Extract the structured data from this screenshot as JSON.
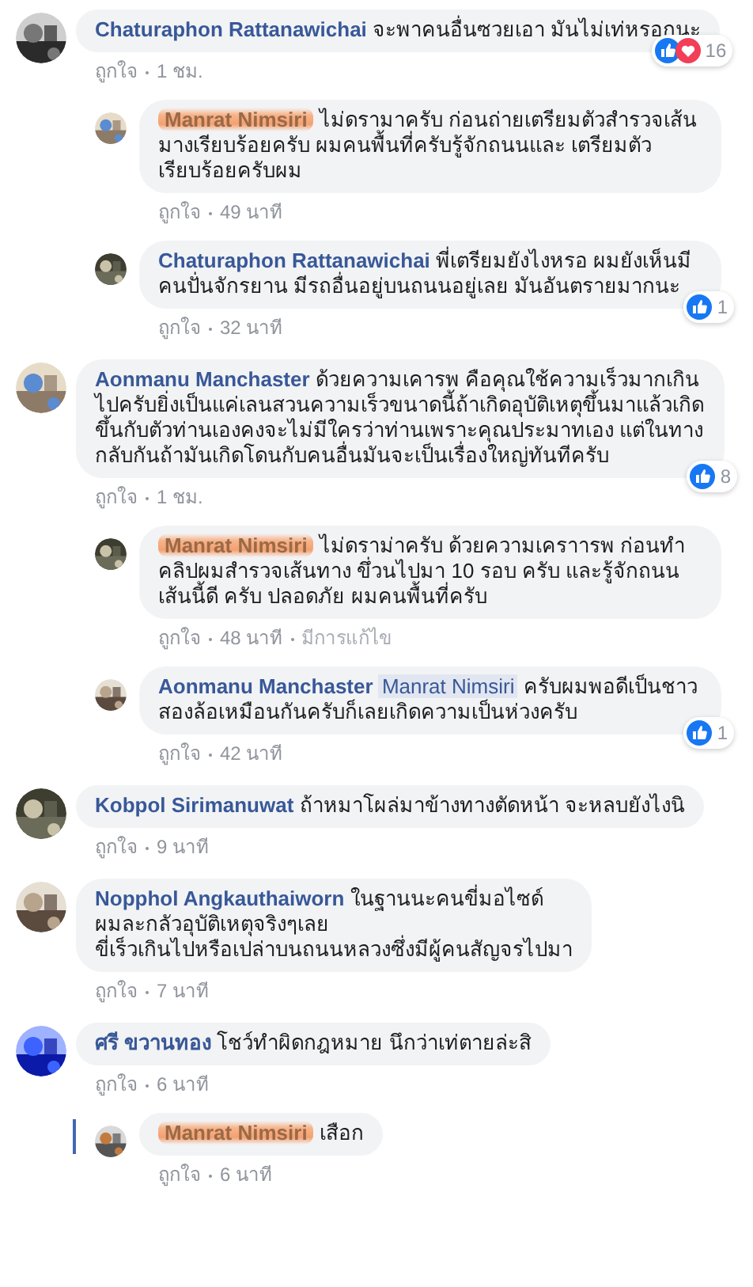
{
  "comments": [
    {
      "author": "Chaturaphon Rattanawichai",
      "redacted": false,
      "text": "จะพาคนอื่นซวยเอา มันไม่เท่หรอกนะ",
      "like": "ถูกใจ",
      "time": "1 ชม.",
      "reactions": {
        "like": true,
        "love": true,
        "count": "16"
      },
      "replies": [
        {
          "author": "Manrat Nimsiri",
          "redacted": true,
          "text": "ไม่ดรามาครับ ก่อนถ่ายเตรียมตัวสำรวจเส้นมางเรียบร้อยครับ ผมคนพื้นที่ครับรู้จักถนนและ เตรียมตัวเรียบร้อยครับผม",
          "like": "ถูกใจ",
          "time": "49 นาที"
        },
        {
          "author": "Chaturaphon Rattanawichai",
          "redacted": false,
          "text": "พี่เตรียมยังไงหรอ ผมยังเห็นมีคนปั่นจักรยาน มีรถอื่นอยู่บนถนนอยู่เลย มันอันตรายมากนะ",
          "like": "ถูกใจ",
          "time": "32 นาที",
          "reactions": {
            "like": true,
            "love": false,
            "count": "1"
          }
        }
      ]
    },
    {
      "author": "Aonmanu Manchaster",
      "redacted": false,
      "text": "ด้วยความเคารพ คือคุณใช้ความเร็วมากเกินไปครับยิ่งเป็นแค่เลนสวนความเร็วขนาดนี้ถ้าเกิดอุบัติเหตุขึ้นมาแล้วเกิดขึ้นกับตัวท่านเองคงจะไม่มีใครว่าท่านเพราะคุณประมาทเอง แต่ในทางกลับกันถ้ามันเกิดโดนกับคนอื่นมันจะเป็นเรื่องใหญ่ทันทีครับ",
      "like": "ถูกใจ",
      "time": "1 ชม.",
      "reactions": {
        "like": true,
        "love": false,
        "count": "8"
      },
      "replies": [
        {
          "author": "Manrat Nimsiri",
          "redacted": true,
          "text": "ไม่ดราม่าครับ ด้วยความเคราารพ ก่อนทำคลิปผมสำรวจเส้นทาง ขึ่วนไปมา 10 รอบ ครับ และรู้จักถนนเส้นนี้ดี ครับ ปลอดภัย ผมคนพื้นที่ครับ",
          "like": "ถูกใจ",
          "time": "48 นาที",
          "edited": "มีการแก้ไข"
        },
        {
          "author": "Aonmanu Manchaster",
          "redacted": false,
          "mention": "Manrat Nimsiri",
          "text": "ครับผมพอดีเป็นชาวสองล้อเหมือนกันครับก็เลยเกิดความเป็นห่วงครับ",
          "like": "ถูกใจ",
          "time": "42 นาที",
          "reactions": {
            "like": true,
            "love": false,
            "count": "1"
          }
        }
      ]
    },
    {
      "author": "Kobpol Sirimanuwat",
      "redacted": false,
      "text": "ถ้าหมาโผล่มาข้างทางตัดหน้า จะหลบยังไงนิ",
      "like": "ถูกใจ",
      "time": "9 นาที"
    },
    {
      "author": "Nopphol Angkauthaiworn",
      "redacted": false,
      "text": "ในฐานนะคนขี่มอไซด์\nผมละกลัวอุบัติเหตุจริงๆเลย\nขี่เร็วเกินไปหรือเปล่าบนถนนหลวงซึ่งมีผู้คนสัญจรไปมา",
      "like": "ถูกใจ",
      "time": "7 นาที"
    },
    {
      "author": "ศรี ขวานทอง",
      "redacted": false,
      "text": "โชว์ทำผิดกฎหมาย นึกว่าเท่ตายล่ะสิ",
      "like": "ถูกใจ",
      "time": "6 นาที",
      "replies": [
        {
          "author": "Manrat Nimsiri",
          "redacted": true,
          "thread_line": true,
          "text": "เสือก",
          "like": "ถูกใจ",
          "time": "6 นาที"
        }
      ]
    }
  ]
}
